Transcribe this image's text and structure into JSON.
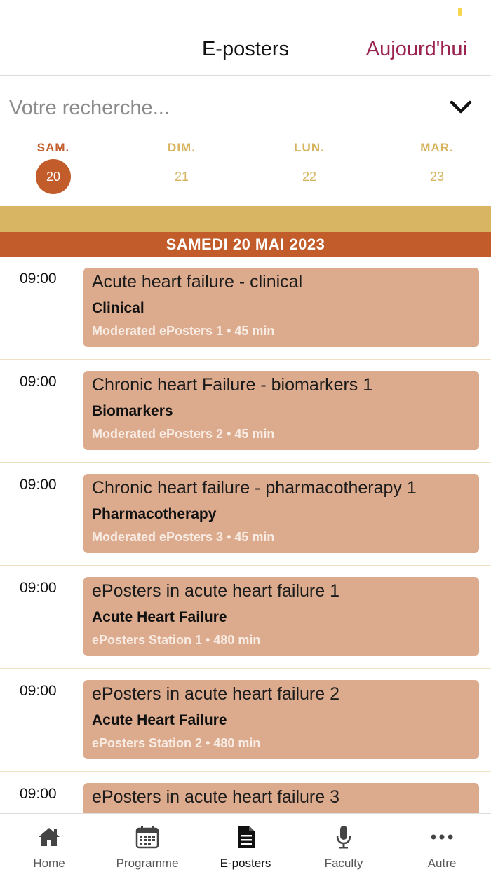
{
  "header": {
    "title": "E-posters",
    "today_label": "Aujourd'hui"
  },
  "search": {
    "placeholder": "Votre recherche..."
  },
  "days": [
    {
      "name": "SAM.",
      "num": "20",
      "selected": true
    },
    {
      "name": "DIM.",
      "num": "21",
      "selected": false
    },
    {
      "name": "LUN.",
      "num": "22",
      "selected": false
    },
    {
      "name": "MAR.",
      "num": "23",
      "selected": false
    }
  ],
  "date_banner": "SAMEDI 20 MAI 2023",
  "sessions": [
    {
      "time": "09:00",
      "title": "Acute heart failure - clinical",
      "category": "Clinical",
      "meta": "Moderated ePosters 1 • 45 min"
    },
    {
      "time": "09:00",
      "title": "Chronic heart Failure - biomarkers 1",
      "category": "Biomarkers",
      "meta": "Moderated ePosters 2 • 45 min"
    },
    {
      "time": "09:00",
      "title": "Chronic heart failure - pharmacotherapy 1",
      "category": "Pharmacotherapy",
      "meta": "Moderated ePosters 3 • 45 min"
    },
    {
      "time": "09:00",
      "title": "ePosters in acute heart failure 1",
      "category": "Acute Heart Failure",
      "meta": "ePosters Station 1 • 480 min"
    },
    {
      "time": "09:00",
      "title": "ePosters in acute heart failure 2",
      "category": "Acute Heart Failure",
      "meta": "ePosters Station 2 • 480 min"
    },
    {
      "time": "09:00",
      "title": "ePosters in acute heart failure 3",
      "category": "",
      "meta": ""
    }
  ],
  "tabs": [
    {
      "label": "Home",
      "icon": "home-icon",
      "active": false
    },
    {
      "label": "Programme",
      "icon": "calendar-icon",
      "active": false
    },
    {
      "label": "E-posters",
      "icon": "document-icon",
      "active": true
    },
    {
      "label": "Faculty",
      "icon": "microphone-icon",
      "active": false
    },
    {
      "label": "Autre",
      "icon": "more-icon",
      "active": false
    }
  ],
  "colors": {
    "accent": "#c25c2a",
    "gold": "#d8b562",
    "card": "#dcab8e",
    "today_link": "#9b2350"
  }
}
